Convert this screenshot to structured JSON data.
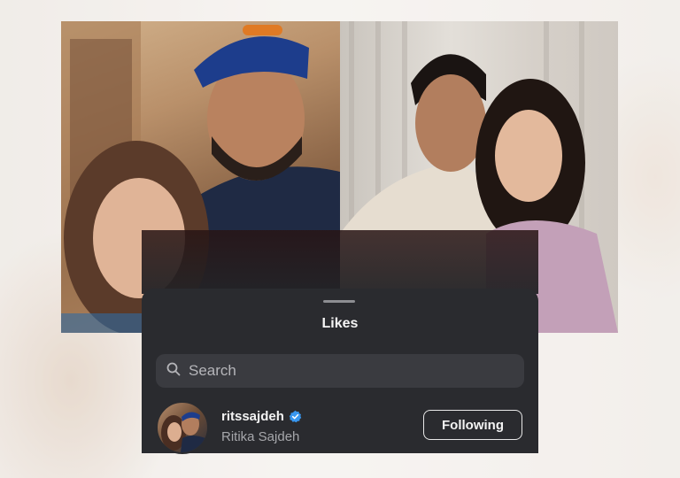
{
  "sheet": {
    "title": "Likes",
    "search": {
      "placeholder": "Search",
      "value": ""
    },
    "users": [
      {
        "username": "ritssajdeh",
        "full_name": "Ritika Sajdeh",
        "verified": true,
        "follow_button_label": "Following"
      }
    ]
  },
  "colors": {
    "sheet_bg": "#2a2b2f",
    "search_bg": "#3a3b40",
    "verified_badge": "#3897f0"
  }
}
